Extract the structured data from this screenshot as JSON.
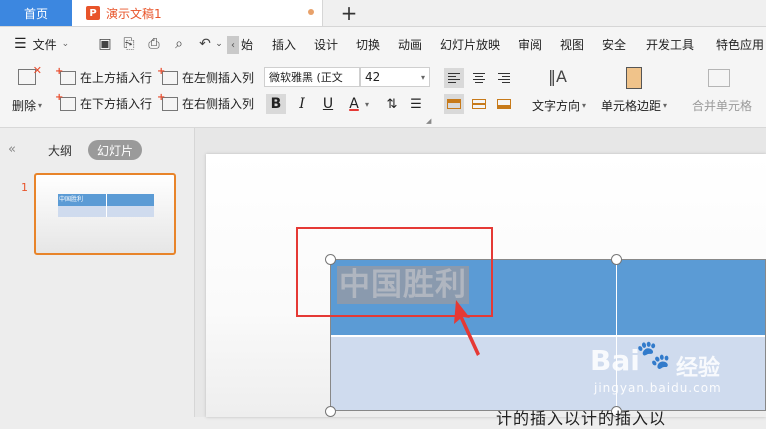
{
  "tabs": {
    "home": "首页",
    "document": "演示文稿1",
    "add": "+"
  },
  "menu": {
    "file": "文件",
    "items": [
      "始",
      "插入",
      "设计",
      "切换",
      "动画",
      "幻灯片放映",
      "审阅",
      "视图",
      "安全",
      "开发工具",
      "特色应用"
    ]
  },
  "ribbon": {
    "delete": "删除",
    "insert_above": "在上方插入行",
    "insert_below": "在下方插入行",
    "insert_left": "在左侧插入列",
    "insert_right": "在右侧插入列",
    "font_family": "微软雅黑 (正文",
    "font_size": "42",
    "bold": "B",
    "italic": "I",
    "underline": "U",
    "font_color": "A",
    "text_direction": "文字方向",
    "cell_margin": "单元格边距",
    "merge_cells": "合并单元格"
  },
  "panel": {
    "outline_tab": "大纲",
    "slides_tab": "幻灯片",
    "slide_number": "1",
    "thumb_text": "中国胜利"
  },
  "slide": {
    "cell_text": "中国胜利",
    "below_text": "计的插入以计的插入以"
  },
  "watermark": {
    "logo": "Bai",
    "name": "经验",
    "url": "jingyan.baidu.com"
  },
  "colors": {
    "accent": "#3c87e0",
    "table_header": "#5b9bd5",
    "table_row": "#cfdbee",
    "highlight_box": "#e53935",
    "active_thumb": "#e8842a"
  }
}
